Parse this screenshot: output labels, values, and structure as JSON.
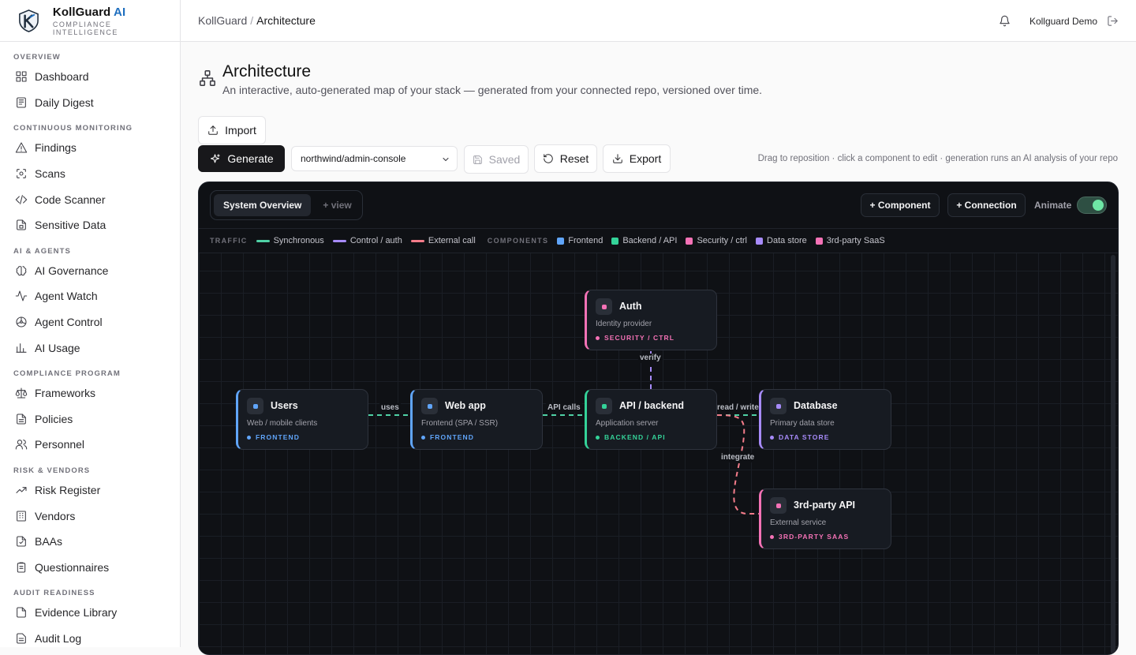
{
  "brand": {
    "name": "KollGuard",
    "ai": "AI",
    "subtitle": "COMPLIANCE INTELLIGENCE"
  },
  "sidebar": {
    "sections": [
      {
        "title": "OVERVIEW",
        "items": [
          {
            "label": "Dashboard",
            "icon": "dashboard-icon"
          },
          {
            "label": "Daily Digest",
            "icon": "newspaper-icon"
          }
        ]
      },
      {
        "title": "CONTINUOUS MONITORING",
        "items": [
          {
            "label": "Findings",
            "icon": "warning-icon"
          },
          {
            "label": "Scans",
            "icon": "scan-icon"
          },
          {
            "label": "Code Scanner",
            "icon": "code-icon"
          },
          {
            "label": "Sensitive Data",
            "icon": "file-lock-icon"
          }
        ]
      },
      {
        "title": "AI & AGENTS",
        "items": [
          {
            "label": "AI Governance",
            "icon": "brain-icon"
          },
          {
            "label": "Agent Watch",
            "icon": "activity-icon"
          },
          {
            "label": "Agent Control",
            "icon": "steering-icon"
          },
          {
            "label": "AI Usage",
            "icon": "bar-chart-icon"
          }
        ]
      },
      {
        "title": "COMPLIANCE PROGRAM",
        "items": [
          {
            "label": "Frameworks",
            "icon": "scale-icon"
          },
          {
            "label": "Policies",
            "icon": "document-icon"
          },
          {
            "label": "Personnel",
            "icon": "users-icon"
          }
        ]
      },
      {
        "title": "RISK & VENDORS",
        "items": [
          {
            "label": "Risk Register",
            "icon": "trending-icon"
          },
          {
            "label": "Vendors",
            "icon": "building-icon"
          },
          {
            "label": "BAAs",
            "icon": "file-text-icon"
          },
          {
            "label": "Questionnaires",
            "icon": "clipboard-icon"
          }
        ]
      },
      {
        "title": "AUDIT READINESS",
        "items": [
          {
            "label": "Evidence Library",
            "icon": "folder-icon"
          },
          {
            "label": "Audit Log",
            "icon": "list-icon"
          }
        ]
      }
    ]
  },
  "topbar": {
    "crumb_root": "KollGuard",
    "crumb_sep": "/",
    "crumb_current": "Architecture",
    "user": "Kollguard Demo"
  },
  "header": {
    "title": "Architecture",
    "subtitle": "An interactive, auto-generated map of your stack — generated from your connected repo, versioned over time."
  },
  "toolbar": {
    "import": "Import",
    "generate": "Generate",
    "repo": "northwind/admin-console",
    "saved": "Saved",
    "reset": "Reset",
    "export": "Export",
    "hint": "Drag to reposition · click a component to edit · generation runs an AI analysis of your repo"
  },
  "canvas": {
    "tab_active": "System Overview",
    "tab_add": "+ view",
    "add_component": "+ Component",
    "add_connection": "+ Connection",
    "animate_label": "Animate",
    "animate_on": true,
    "legend": {
      "traffic_title": "TRAFFIC",
      "traffic": [
        {
          "label": "Synchronous",
          "color": "#4fd1a5"
        },
        {
          "label": "Control / auth",
          "color": "#a78bfa"
        },
        {
          "label": "External call",
          "color": "#f47c8a"
        }
      ],
      "components_title": "COMPONENTS",
      "components": [
        {
          "label": "Frontend",
          "color": "#60a5fa"
        },
        {
          "label": "Backend / API",
          "color": "#34d399"
        },
        {
          "label": "Security / ctrl",
          "color": "#f472b6"
        },
        {
          "label": "Data store",
          "color": "#a78bfa"
        },
        {
          "label": "3rd-party SaaS",
          "color": "#f472b6"
        }
      ]
    },
    "nodes": [
      {
        "id": "users",
        "title": "Users",
        "subtitle": "Web / mobile clients",
        "tag": "FRONTEND",
        "color": "#60a5fa"
      },
      {
        "id": "webapp",
        "title": "Web app",
        "subtitle": "Frontend (SPA / SSR)",
        "tag": "FRONTEND",
        "color": "#60a5fa"
      },
      {
        "id": "auth",
        "title": "Auth",
        "subtitle": "Identity provider",
        "tag": "SECURITY / CTRL",
        "color": "#f472b6"
      },
      {
        "id": "api",
        "title": "API / backend",
        "subtitle": "Application server",
        "tag": "BACKEND / API",
        "color": "#34d399"
      },
      {
        "id": "db",
        "title": "Database",
        "subtitle": "Primary data store",
        "tag": "DATA STORE",
        "color": "#a78bfa"
      },
      {
        "id": "thirdparty",
        "title": "3rd-party API",
        "subtitle": "External service",
        "tag": "3RD-PARTY SAAS",
        "color": "#f472b6"
      }
    ],
    "edges": [
      {
        "from": "users",
        "to": "webapp",
        "label": "uses"
      },
      {
        "from": "webapp",
        "to": "api",
        "label": "API calls"
      },
      {
        "from": "api",
        "to": "auth",
        "label": "verify"
      },
      {
        "from": "api",
        "to": "db",
        "label": "read / write"
      },
      {
        "from": "api",
        "to": "thirdparty",
        "label": "integrate"
      }
    ]
  }
}
